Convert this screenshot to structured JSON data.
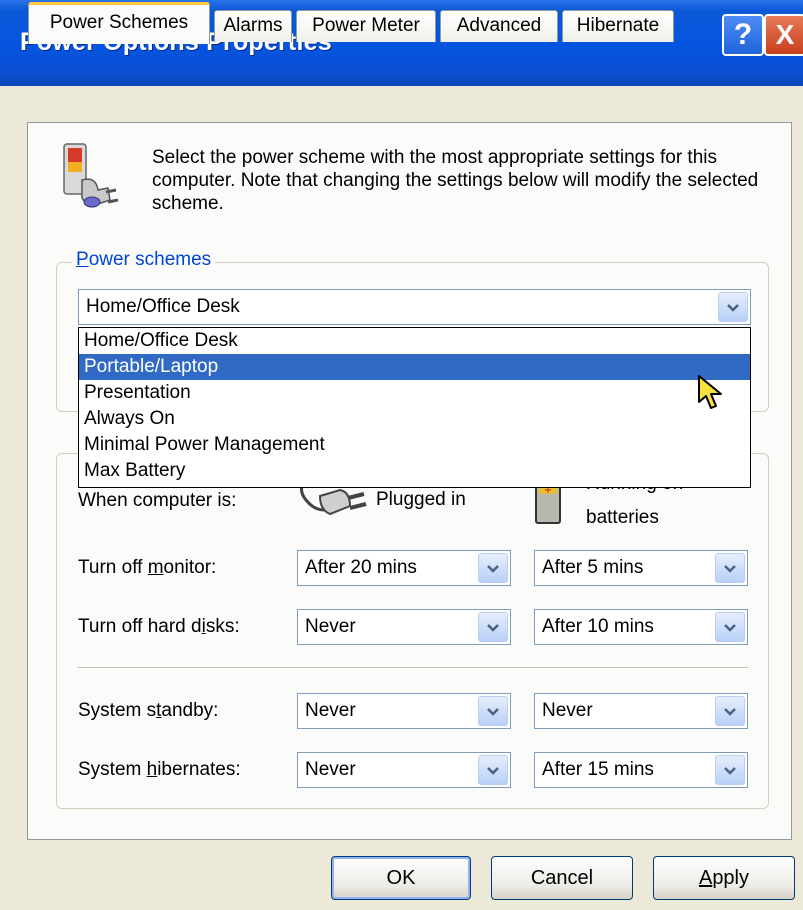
{
  "window": {
    "title": "Power Options Properties",
    "help_glyph": "?",
    "close_glyph": "X"
  },
  "tabs": [
    {
      "label": "Power Schemes",
      "active": true
    },
    {
      "label": "Alarms"
    },
    {
      "label": "Power Meter"
    },
    {
      "label": "Advanced"
    },
    {
      "label": "Hibernate"
    }
  ],
  "intro_text": "Select the power scheme with the most appropriate settings for this computer. Note that changing the settings below will modify the selected scheme.",
  "power_schemes": {
    "legend_accel": "P",
    "legend_rest": "ower schemes",
    "selected": "Home/Office Desk",
    "options": [
      "Home/Office Desk",
      "Portable/Laptop",
      "Presentation",
      "Always On",
      "Minimal Power Management",
      "Max Battery"
    ],
    "highlighted_index": 1
  },
  "settings": {
    "header_label": "When computer is:",
    "plugged_in_label": "Plugged in",
    "batteries_label_line1": "Running on",
    "batteries_label_line2": "batteries",
    "monitor": {
      "pre": "Turn off ",
      "accel": "m",
      "post": "onitor:",
      "plugged": "After 20 mins",
      "battery": "After 5 mins"
    },
    "hard_disks": {
      "pre": "Turn off hard d",
      "accel": "i",
      "post": "sks:",
      "plugged": "Never",
      "battery": "After 10 mins"
    },
    "standby": {
      "pre": "System s",
      "accel": "t",
      "post": "andby:",
      "plugged": "Never",
      "battery": "Never"
    },
    "hibernates": {
      "pre": "System ",
      "accel": "h",
      "post": "ibernates:",
      "plugged": "Never",
      "battery": "After 15 mins"
    }
  },
  "buttons": {
    "ok": "OK",
    "cancel": "Cancel",
    "apply_accel": "A",
    "apply_rest": "pply"
  },
  "colors": {
    "title_bar": "#0554e0",
    "highlight": "#316ac5",
    "legend": "#0046d5",
    "tab_accent": "#ffc83c"
  }
}
